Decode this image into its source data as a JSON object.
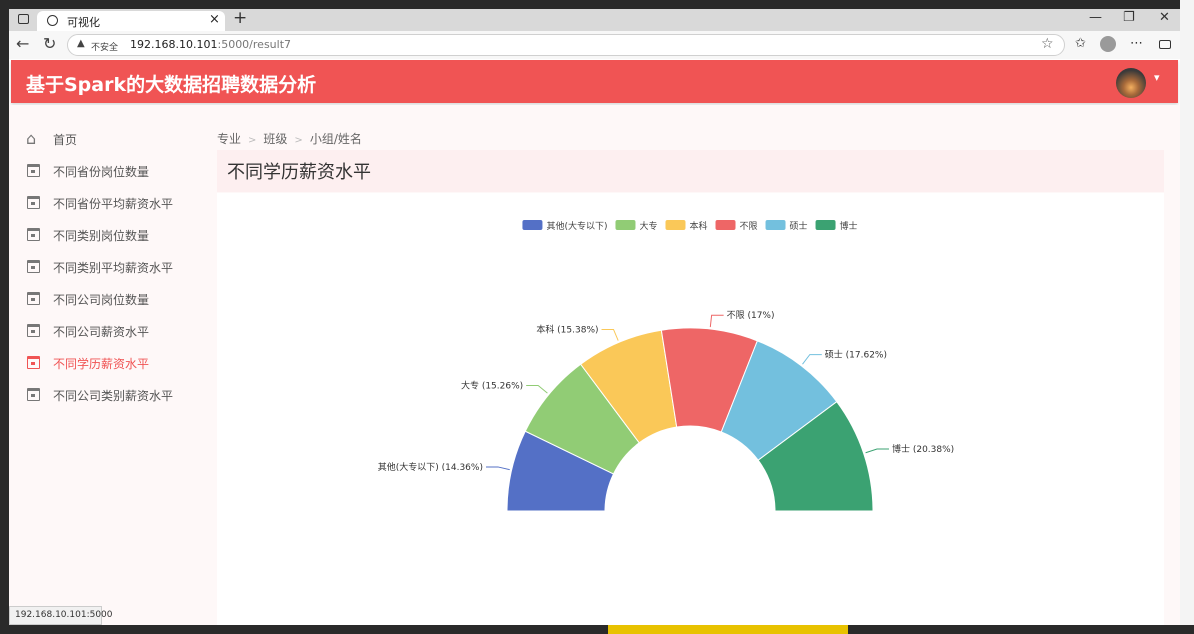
{
  "browser": {
    "tab_title": "可视化",
    "tab_close": "×",
    "new_tab": "+",
    "minimize": "—",
    "restore": "❐",
    "close": "✕",
    "insecure_label": "不安全",
    "url_host": "192.168.10.101",
    "url_rest": ":5000/result7",
    "status_url": "192.168.10.101:5000"
  },
  "header": {
    "title": "基于Spark的大数据招聘数据分析"
  },
  "sidebar": {
    "items": [
      {
        "label": "首页",
        "icon": "home-icon"
      },
      {
        "label": "不同省份岗位数量",
        "icon": "calendar-icon"
      },
      {
        "label": "不同省份平均薪资水平",
        "icon": "calendar-icon"
      },
      {
        "label": "不同类别岗位数量",
        "icon": "calendar-icon"
      },
      {
        "label": "不同类别平均薪资水平",
        "icon": "calendar-icon"
      },
      {
        "label": "不同公司岗位数量",
        "icon": "calendar-icon"
      },
      {
        "label": "不同公司薪资水平",
        "icon": "calendar-icon"
      },
      {
        "label": "不同学历薪资水平",
        "icon": "calendar-icon",
        "active": true
      },
      {
        "label": "不同公司类别薪资水平",
        "icon": "calendar-icon"
      }
    ]
  },
  "breadcrumb": {
    "items": [
      "专业",
      "班级",
      "小组/姓名"
    ],
    "separator": ">"
  },
  "card": {
    "title": "不同学历薪资水平"
  },
  "colors": {
    "accent": "#f05454"
  },
  "chart_data": {
    "type": "pie",
    "variant": "half-donut",
    "legend_position": "top",
    "categories": [
      "其他(大专以下)",
      "大专",
      "本科",
      "不限",
      "硕士",
      "博士"
    ],
    "values": [
      14.36,
      15.26,
      15.38,
      17,
      17.62,
      20.38
    ],
    "labels": [
      "其他(大专以下) (14.36%)",
      "大专 (15.26%)",
      "本科 (15.38%)",
      "不限 (17%)",
      "硕士 (17.62%)",
      "博士 (20.38%)"
    ],
    "colors": [
      "#5470c6",
      "#91cc75",
      "#fac858",
      "#ee6666",
      "#73c0de",
      "#3ba272"
    ]
  }
}
